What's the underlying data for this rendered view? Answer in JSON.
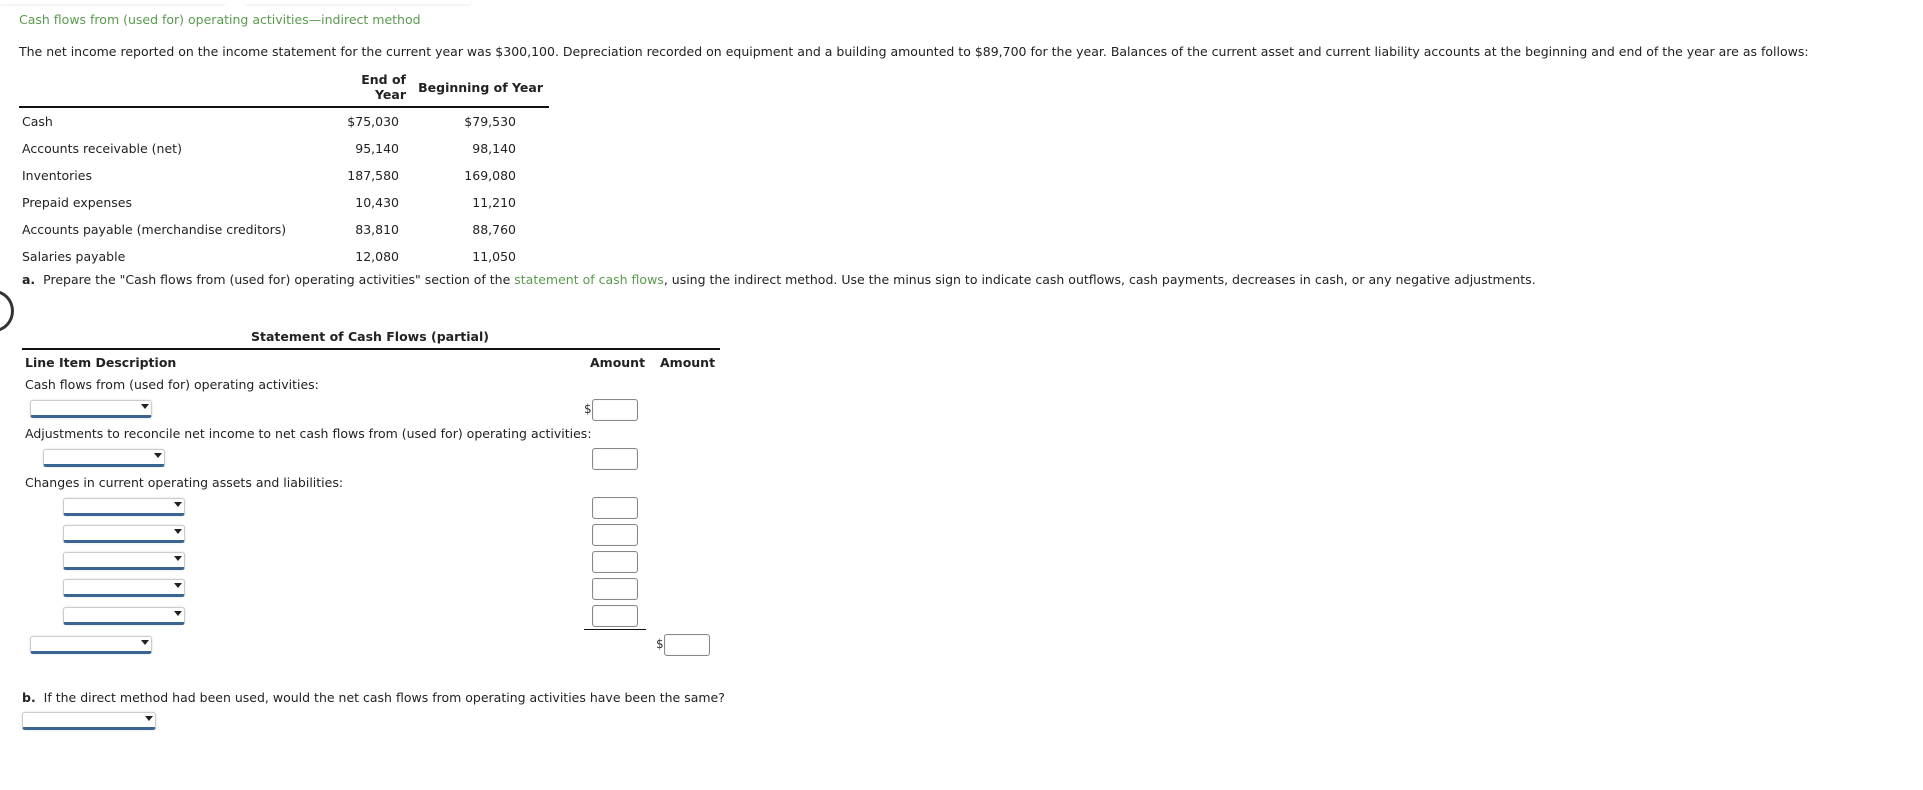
{
  "page": {
    "title": "Cash flows from (used for) operating activities—indirect method",
    "intro": "The net income reported on the income statement for the current year was $300,100. Depreciation recorded on equipment and a building amounted to $89,700 for the year. Balances of the current asset and current liability accounts at the beginning and end of the year are as follows:"
  },
  "given_table": {
    "headers": [
      "",
      "End of Year",
      "Beginning of Year"
    ],
    "rows": [
      {
        "label": "Cash",
        "end": "$75,030",
        "begin": "$79,530"
      },
      {
        "label": "Accounts receivable (net)",
        "end": "95,140",
        "begin": "98,140"
      },
      {
        "label": "Inventories",
        "end": "187,580",
        "begin": "169,080"
      },
      {
        "label": "Prepaid expenses",
        "end": "10,430",
        "begin": "11,210"
      },
      {
        "label": "Accounts payable (merchandise creditors)",
        "end": "83,810",
        "begin": "88,760"
      },
      {
        "label": "Salaries payable",
        "end": "12,080",
        "begin": "11,050"
      }
    ]
  },
  "part_a": {
    "marker": "a.",
    "text_before": "Prepare the \"Cash flows from (used for) operating activities\" section of the ",
    "link": "statement of cash flows",
    "text_after": ", using the indirect method. Use the minus sign to indicate cash outflows, cash payments, decreases in cash, or any negative adjustments."
  },
  "statement": {
    "title": "Statement of Cash Flows (partial)",
    "col_desc": "Line Item Description",
    "col_amount1": "Amount",
    "col_amount2": "Amount",
    "section_operating": "Cash flows from (used for) operating activities:",
    "section_adjustments": "Adjustments to reconcile net income to net cash flows from (used for) operating activities:",
    "section_changes": "Changes in current operating assets and liabilities:",
    "currency": "$",
    "selects": {
      "net_income": "",
      "depreciation": "",
      "change_1": "",
      "change_2": "",
      "change_3": "",
      "change_4": "",
      "change_5": "",
      "net_cash": ""
    },
    "inputs": {
      "net_income": "",
      "depreciation": "",
      "change_1": "",
      "change_2": "",
      "change_3": "",
      "change_4": "",
      "change_5": "",
      "net_cash": ""
    }
  },
  "part_b": {
    "marker": "b.",
    "text": "If the direct method had been used, would the net cash flows from operating activities have been the same?",
    "answer": ""
  },
  "colors": {
    "link_green": "#5a9a4f",
    "select_underline": "#3a6590"
  }
}
